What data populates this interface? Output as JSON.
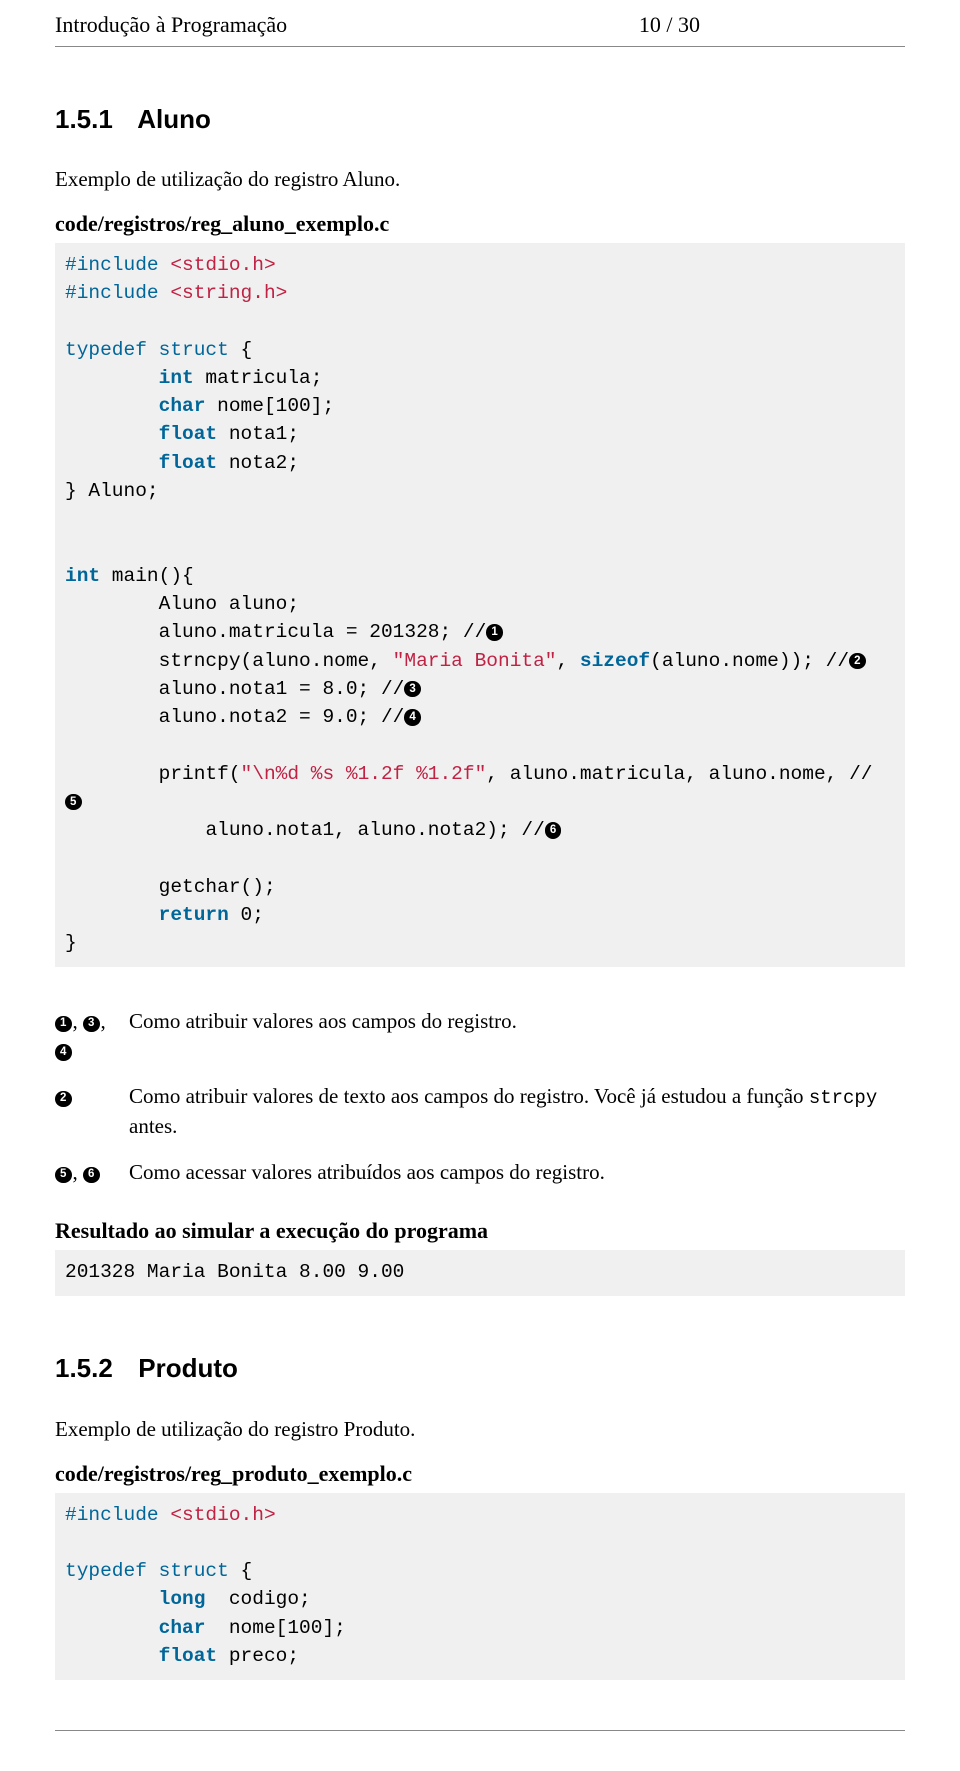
{
  "header": {
    "title": "Introdução à Programação",
    "page": "10 / 30"
  },
  "sections": [
    {
      "id": "aluno",
      "number": "1.5.1",
      "title": "Aluno",
      "intro": "Exemplo de utilização do registro Aluno.",
      "file": "code/registros/reg_aluno_exemplo.c",
      "code": {
        "l01a": "#include",
        "l01b": "<stdio.h>",
        "l02a": "#include",
        "l02b": "<string.h>",
        "l03a": "typedef struct",
        "l03b": " {",
        "l04a": "int",
        "l04b": " matricula;",
        "l05a": "char",
        "l05b": " nome[100];",
        "l06a": "float",
        "l06b": " nota1;",
        "l07a": "float",
        "l07b": " nota2;",
        "l08": "} Aluno;",
        "l09a": "int",
        "l09b": " main(){",
        "l10": "Aluno aluno;",
        "l11a": "aluno.matricula = 201328; ",
        "l12a": "strncpy(aluno.nome, ",
        "l12s": "\"Maria Bonita\"",
        "l12b": ", ",
        "l12c": "sizeof",
        "l12d": "(aluno.nome)); ",
        "l13": "aluno.nota1 = 8.0; ",
        "l14": "aluno.nota2 = 9.0; ",
        "l15a": "printf(",
        "l15s": "\"\\n%d %s %1.2f %1.2f\"",
        "l15b": ", aluno.matricula, aluno.nome, ",
        "l16": "aluno.nota1, aluno.nota2); ",
        "l17": "getchar();",
        "l18a": "return",
        "l18b": " 0;",
        "l19": "}"
      },
      "callouts": [
        {
          "marks": "❶, ❸, ❹",
          "text": "Como atribuir valores aos campos do registro."
        },
        {
          "marks": "❷",
          "text_a": "Como atribuir valores de texto aos campos do registro. Você já estudou a função ",
          "code": "strcpy",
          "text_b": " antes."
        },
        {
          "marks": "❺, ❻",
          "text": "Como acessar valores atribuídos aos campos do registro."
        }
      ],
      "result_label": "Resultado ao simular a execução do programa",
      "result": "201328 Maria Bonita 8.00 9.00"
    },
    {
      "id": "produto",
      "number": "1.5.2",
      "title": "Produto",
      "intro": "Exemplo de utilização do registro Produto.",
      "file": "code/registros/reg_produto_exemplo.c",
      "code": {
        "l01a": "#include",
        "l01b": "<stdio.h>",
        "l02a": "typedef struct",
        "l02b": " {",
        "l03a": "long",
        "l03b": "  codigo;",
        "l04a": "char",
        "l04b": "  nome[100];",
        "l05a": "float",
        "l05b": " preco;"
      }
    }
  ],
  "callout_glyphs": [
    "1",
    "2",
    "3",
    "4",
    "5",
    "6"
  ]
}
